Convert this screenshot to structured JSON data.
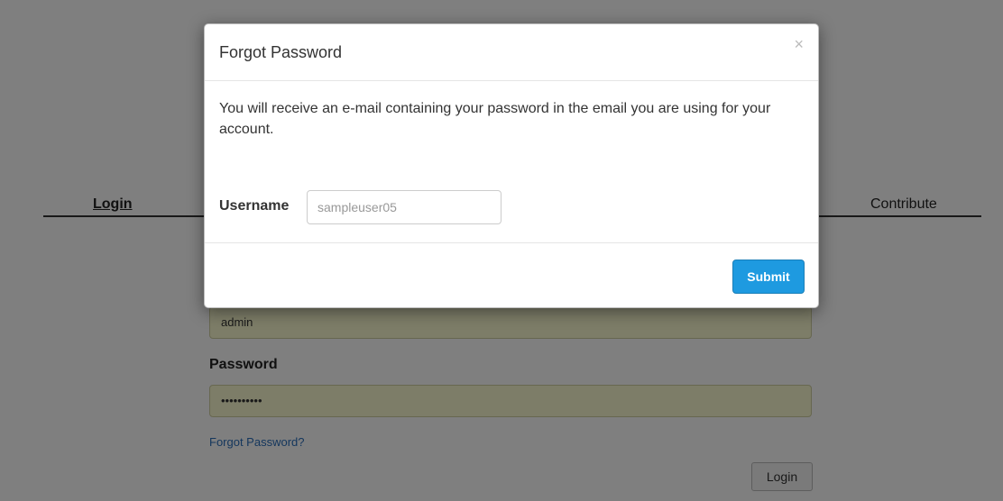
{
  "nav": {
    "login_label": "Login",
    "contribute_label": "Contribute"
  },
  "login_form": {
    "username_value": "admin",
    "password_label": "Password",
    "password_value": "••••••••••",
    "forgot_link": "Forgot Password?",
    "login_button": "Login"
  },
  "modal": {
    "title": "Forgot Password",
    "close_glyph": "×",
    "message": "You will receive an e-mail containing your password in the email you are using for your account.",
    "username_label": "Username",
    "username_placeholder": "sampleuser05",
    "submit_label": "Submit"
  },
  "colors": {
    "submit_bg": "#1e9ae0",
    "autofill_bg": "#fafad0",
    "link": "#2a6ebb",
    "backdrop": "rgba(0,0,0,0.5)"
  }
}
